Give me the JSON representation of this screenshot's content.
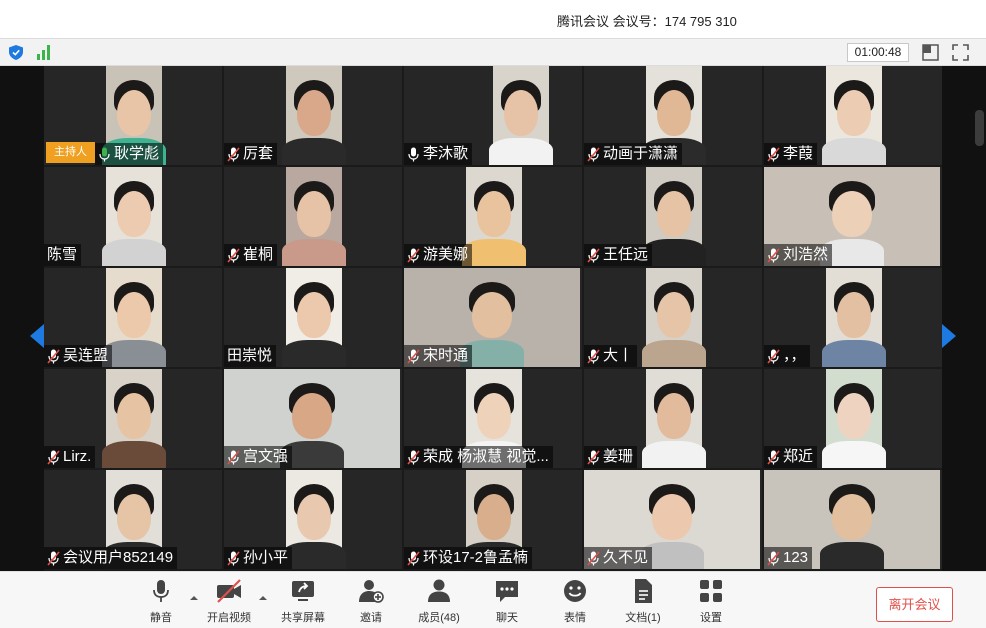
{
  "window": {
    "title": "腾讯会议 会议号：174 795 310"
  },
  "infobar": {
    "timer": "01:00:48"
  },
  "host_badge": "主持人",
  "participants": [
    [
      "耿学彪",
      "厉套",
      "李沐歌",
      "动画于潇潇",
      "李葭"
    ],
    [
      "陈雪",
      "崔桐",
      "游美娜",
      "王任远",
      "刘浩然"
    ],
    [
      "吴连盟",
      "田崇悦",
      "宋时通",
      "大丨",
      "，，"
    ],
    [
      "Lirz.",
      "宫文强",
      "荣成 杨淑慧 视觉...",
      "姜珊",
      "郑近"
    ],
    [
      "会议用户852149",
      "孙小平",
      "环设17-2鲁孟楠",
      "久不见",
      "123"
    ]
  ],
  "toolbar": {
    "mute": "静音",
    "video": "开启视频",
    "share": "共享屏幕",
    "invite": "邀请",
    "members": "成员(48)",
    "chat": "聊天",
    "reactions": "表情",
    "docs": "文档(1)",
    "settings": "设置",
    "leave": "离开会议"
  },
  "colors": {
    "accent": "#1e7ae0",
    "host_badge": "#f0a020",
    "leave": "#e0504a",
    "signal": "#3cb44b",
    "shield": "#1e7ae0"
  }
}
